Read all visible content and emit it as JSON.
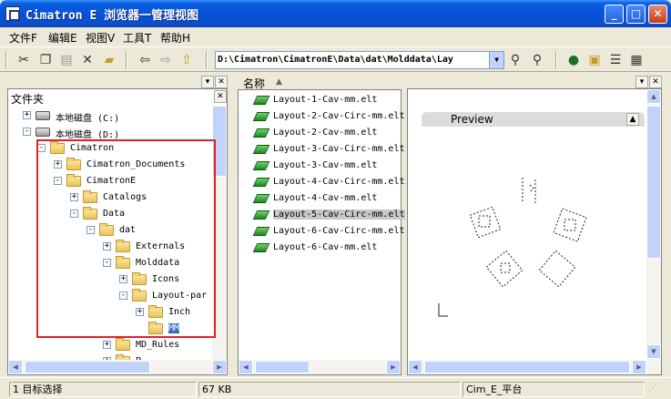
{
  "window": {
    "title": "Cimatron E 浏览器一管理视图"
  },
  "menu": [
    {
      "label": "文件F"
    },
    {
      "label": "编辑E"
    },
    {
      "label": "视图V"
    },
    {
      "label": "工具T"
    },
    {
      "label": "帮助H"
    }
  ],
  "toolbar": {
    "path": "D:\\Cimatron\\CimatronE\\Data\\dat\\Molddata\\Lay"
  },
  "tree_pane": {
    "caption": "文件夹"
  },
  "tree": [
    {
      "label": "本地磁盘 (C:)",
      "type": "drive",
      "expander": "+"
    },
    {
      "label": "本地磁盘 (D:)",
      "type": "drive",
      "expander": "-"
    },
    {
      "label": "Cimatron",
      "type": "folder",
      "expander": "-"
    },
    {
      "label": "Cimatron_Documents",
      "type": "folder",
      "expander": "+"
    },
    {
      "label": "CimatronE",
      "type": "folder",
      "expander": "-"
    },
    {
      "label": "Catalogs",
      "type": "folder",
      "expander": "+"
    },
    {
      "label": "Data",
      "type": "folder",
      "expander": "-"
    },
    {
      "label": "dat",
      "type": "folder",
      "expander": "-"
    },
    {
      "label": "Externals",
      "type": "folder",
      "expander": "+"
    },
    {
      "label": "Molddata",
      "type": "folder",
      "expander": "-"
    },
    {
      "label": "Icons",
      "type": "folder",
      "expander": "+"
    },
    {
      "label": "Layout-par",
      "type": "folder",
      "expander": "-"
    },
    {
      "label": "Inch",
      "type": "folder",
      "expander": "+"
    },
    {
      "label": "MM",
      "type": "folder",
      "expander": "",
      "selected": true
    },
    {
      "label": "MD_Rules",
      "type": "folder",
      "expander": "+"
    },
    {
      "label": "P",
      "type": "folder",
      "expander": "+"
    }
  ],
  "file_pane": {
    "column_name": "名称"
  },
  "files": [
    {
      "name": "Layout-1-Cav-mm.elt"
    },
    {
      "name": "Layout-2-Cav-Circ-mm.elt"
    },
    {
      "name": "Layout-2-Cav-mm.elt"
    },
    {
      "name": "Layout-3-Cav-Circ-mm.elt"
    },
    {
      "name": "Layout-3-Cav-mm.elt"
    },
    {
      "name": "Layout-4-Cav-Circ-mm.elt"
    },
    {
      "name": "Layout-4-Cav-mm.elt"
    },
    {
      "name": "Layout-5-Cav-Circ-mm.elt",
      "selected": true
    },
    {
      "name": "Layout-6-Cav-Circ-mm.elt"
    },
    {
      "name": "Layout-6-Cav-mm.elt"
    }
  ],
  "preview": {
    "title": "Preview"
  },
  "status": {
    "count_selected": "1 目标选择",
    "size": "67 KB",
    "platform": "Cim_E_平台"
  }
}
